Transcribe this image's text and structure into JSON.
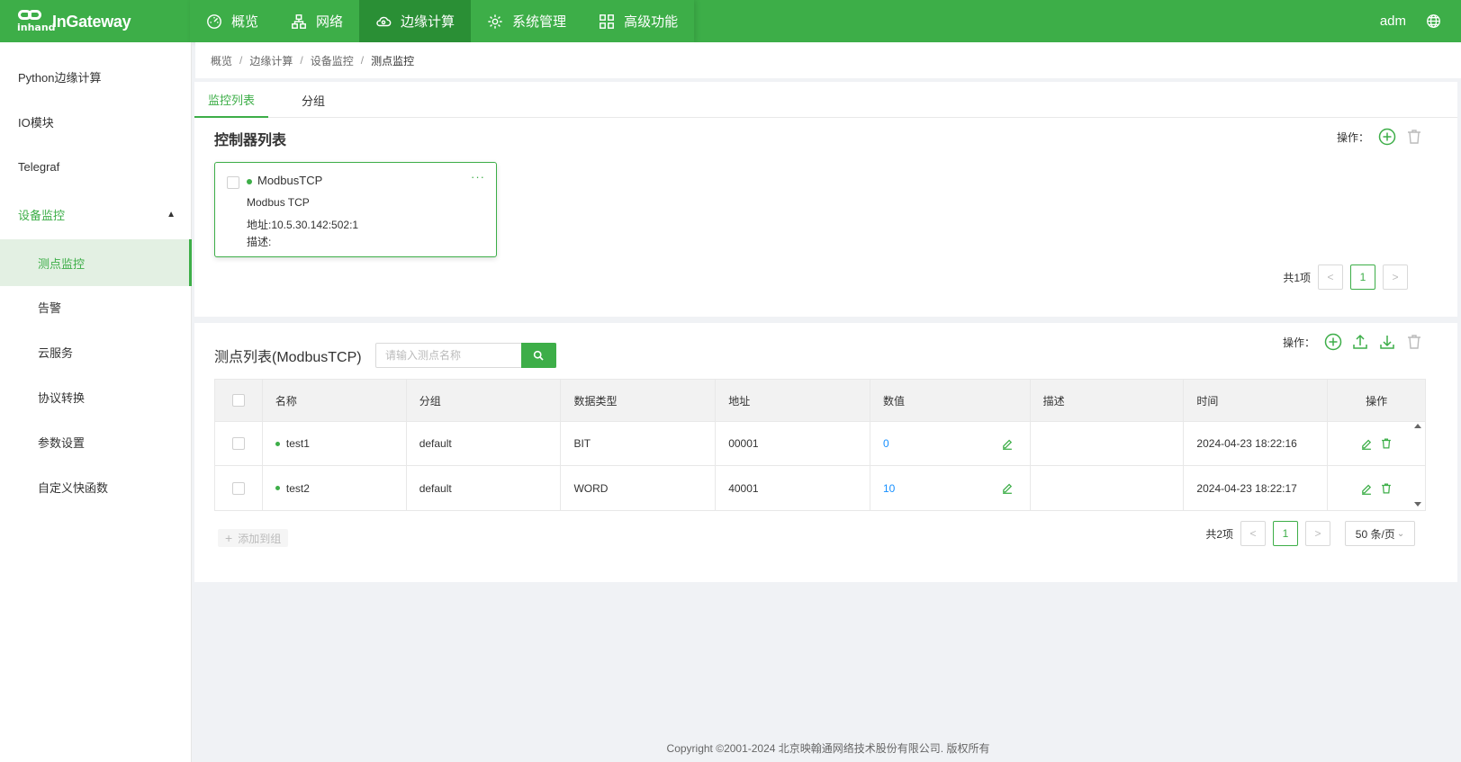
{
  "app": {
    "logo_sub": "inhand",
    "logo_text": "InGateway",
    "brand_color": "#3dae48",
    "user": "adm"
  },
  "topnav": [
    {
      "label": "概览",
      "icon": "dashboard-icon"
    },
    {
      "label": "网络",
      "icon": "network-icon"
    },
    {
      "label": "边缘计算",
      "icon": "cloud-compute-icon",
      "active": true
    },
    {
      "label": "系统管理",
      "icon": "gear-icon"
    },
    {
      "label": "高级功能",
      "icon": "grid-icon"
    }
  ],
  "sidebar": {
    "items": [
      {
        "label": "Python边缘计算"
      },
      {
        "label": "IO模块"
      },
      {
        "label": "Telegraf"
      },
      {
        "label": "设备监控",
        "expanded": true
      },
      {
        "label": "测点监控",
        "selected": true
      },
      {
        "label": "告警"
      },
      {
        "label": "云服务"
      },
      {
        "label": "协议转换"
      },
      {
        "label": "参数设置"
      },
      {
        "label": "自定义快函数"
      }
    ]
  },
  "breadcrumb": [
    "概览",
    "边缘计算",
    "设备监控",
    "测点监控"
  ],
  "tabs": [
    {
      "label": "监控列表",
      "active": true
    },
    {
      "label": "分组"
    }
  ],
  "controllers": {
    "title": "控制器列表",
    "ops_label": "操作：",
    "card": {
      "name": "ModbusTCP",
      "protocol": "Modbus TCP",
      "address": "地址:10.5.30.142:502:1",
      "description": "描述:",
      "more": "···"
    },
    "pager": {
      "total": "共1项",
      "page": "1",
      "prev": "<",
      "next": ">"
    }
  },
  "points": {
    "title": "测点列表(ModbusTCP)",
    "search_placeholder": "请输入测点名称",
    "ops_label": "操作：",
    "columns": [
      "名称",
      "分组",
      "数据类型",
      "地址",
      "数值",
      "描述",
      "时间",
      "操作"
    ],
    "rows": [
      {
        "name": "test1",
        "group": "default",
        "type": "BIT",
        "address": "00001",
        "value": "0",
        "desc": "",
        "time": "2024-04-23 18:22:16"
      },
      {
        "name": "test2",
        "group": "default",
        "type": "WORD",
        "address": "40001",
        "value": "10",
        "desc": "",
        "time": "2024-04-23 18:22:17"
      }
    ],
    "add_group": "添加到组",
    "pager": {
      "total": "共2项",
      "page": "1",
      "prev": "<",
      "next": ">",
      "page_size": "50 条/页"
    }
  },
  "footer": "Copyright ©2001-2024 北京映翰通网络技术股份有限公司. 版权所有"
}
